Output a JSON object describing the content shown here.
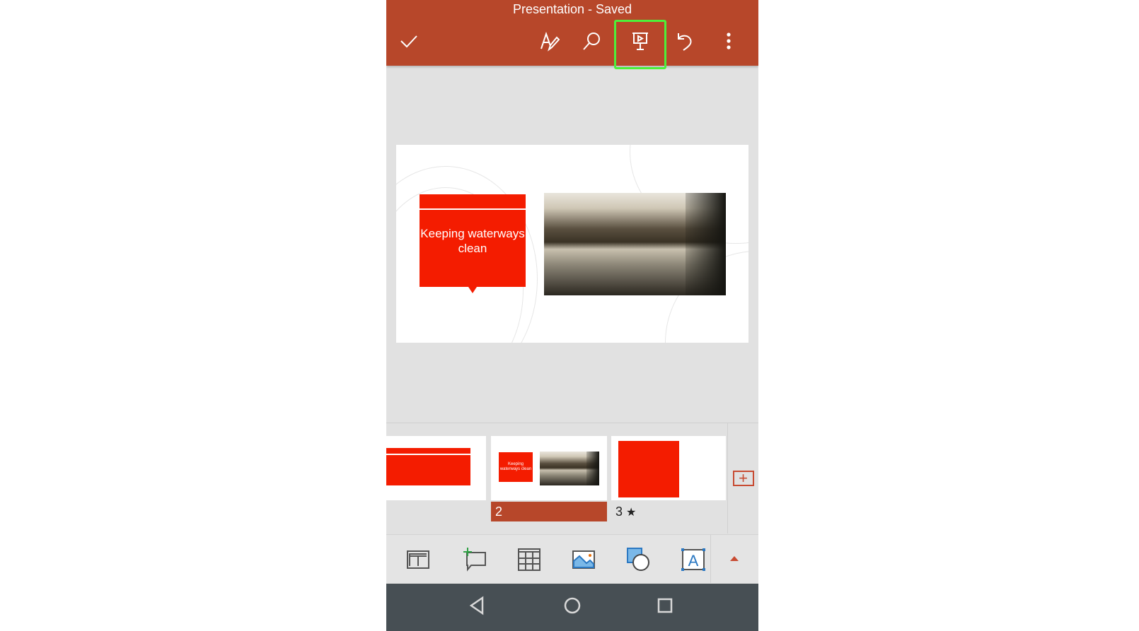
{
  "header": {
    "title": "Presentation - Saved",
    "icons": [
      "checkmark-icon",
      "draw-pen-icon",
      "search-icon",
      "present-icon",
      "undo-icon",
      "more-vertical-icon"
    ],
    "highlighted": "present-icon",
    "highlight_color": "#4cf03a",
    "bg": "#b7472a"
  },
  "slide": {
    "callout_text": "Keeping waterways clean",
    "accent": "#f41c00"
  },
  "thumbnails": [
    {
      "number": "",
      "selected": false
    },
    {
      "number": "2",
      "selected": true,
      "text": "Keeping waterways clean"
    },
    {
      "number": "3",
      "selected": false,
      "badge": "animation-star-icon",
      "badge_glyph": "★"
    }
  ],
  "add_slide": "+",
  "toolbar": {
    "icons": [
      "layout-icon",
      "new-comment-icon",
      "table-icon",
      "picture-icon",
      "shapes-icon",
      "textbox-icon",
      "expand-up-icon"
    ],
    "textbox_letter": "A"
  },
  "navbar": {
    "icons": [
      "back-icon",
      "home-icon",
      "recents-icon"
    ]
  }
}
